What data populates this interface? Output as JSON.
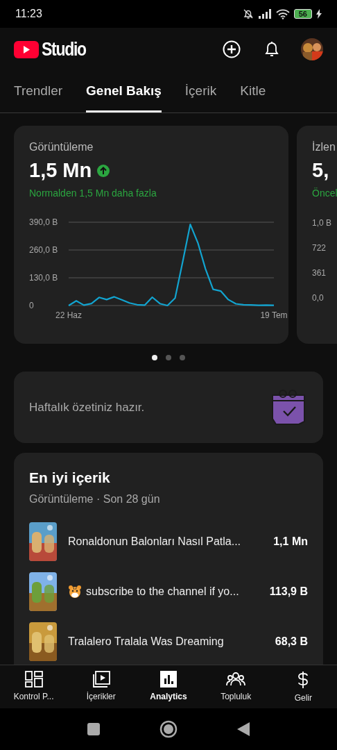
{
  "status_bar": {
    "time": "11:23",
    "battery": "56"
  },
  "header": {
    "logo_text": "Studio"
  },
  "tabs": [
    {
      "label": "Trendler",
      "selected": false
    },
    {
      "label": "Genel Bakış",
      "selected": true
    },
    {
      "label": "İçerik",
      "selected": false
    },
    {
      "label": "Kitle",
      "selected": false
    }
  ],
  "metric_cards": [
    {
      "title": "Görüntüleme",
      "value": "1,5 Mn",
      "rising": true,
      "note": "Normalden 1,5 Mn daha fazla",
      "chart_data": {
        "type": "line",
        "categories": [
          "22 Haz",
          null,
          null,
          null,
          null,
          null,
          null,
          null,
          null,
          null,
          null,
          null,
          null,
          null,
          null,
          null,
          null,
          null,
          null,
          null,
          null,
          null,
          null,
          null,
          null,
          null,
          null,
          "19 Tem"
        ],
        "ylim": [
          0,
          390
        ],
        "yticks": [
          {
            "value": 390,
            "label": "390,0 B"
          },
          {
            "value": 260,
            "label": "260,0 B"
          },
          {
            "value": 130,
            "label": "130,0 B"
          },
          {
            "value": 0,
            "label": "0"
          }
        ],
        "series": [
          {
            "color": "#12a4d0",
            "values": [
              0,
              22,
              2,
              9,
              38,
              28,
              41,
              27,
              12,
              4,
              2,
              39,
              9,
              0,
              35,
              204,
              380,
              293,
              172,
              76,
              68,
              28,
              8,
              4,
              3,
              1,
              2,
              1
            ]
          }
        ]
      }
    },
    {
      "title": "İzlen",
      "value": "5,",
      "note": "Öncel",
      "axis_labels": [
        "1,0 B",
        "722",
        "361",
        "0,0"
      ]
    }
  ],
  "pager": [
    {
      "selected": true
    },
    {
      "selected": false
    },
    {
      "selected": false
    }
  ],
  "weekly_card": {
    "text": "Haftalık özetiniz hazır."
  },
  "top_content": {
    "title": "En iyi içerik",
    "subtitle": "Görüntüleme · Son 28 gün",
    "items": [
      {
        "kind": "plain",
        "title": "Ronaldonun Balonları Nasıl Patla...",
        "views": "1,1 Mn"
      },
      {
        "kind": "with_icon",
        "title": "subscribe to the channel if yo...",
        "views": "113,9 B"
      },
      {
        "kind": "plain",
        "title": "Tralalero Tralala Was Dreaming",
        "views": "68,3 B"
      }
    ]
  },
  "bottom_nav": [
    {
      "label": "Kontrol P...",
      "selected": false
    },
    {
      "label": "İçerikler",
      "selected": false
    },
    {
      "label": "Analytics",
      "selected": true
    },
    {
      "label": "Topluluk",
      "selected": false
    },
    {
      "label": "Gelir",
      "selected": false
    }
  ]
}
